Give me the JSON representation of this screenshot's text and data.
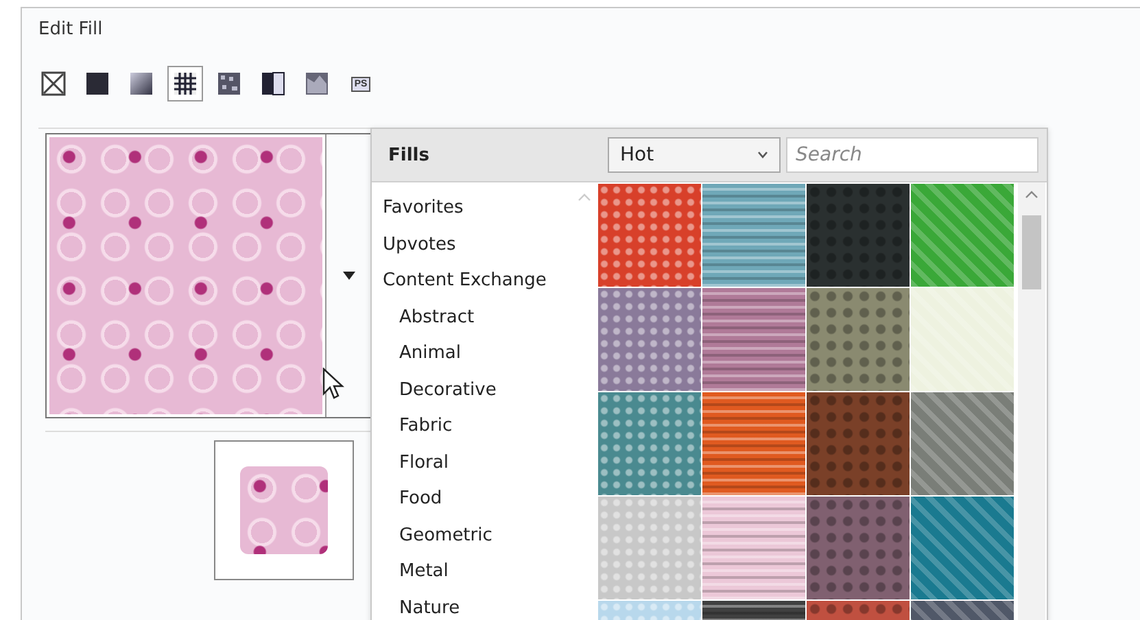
{
  "window": {
    "title": "Edit Fill"
  },
  "fill_types": [
    {
      "kind": "none",
      "selected": false
    },
    {
      "kind": "uniform",
      "selected": false
    },
    {
      "kind": "fountain",
      "selected": false
    },
    {
      "kind": "vector-pattern",
      "selected": true
    },
    {
      "kind": "bitmap-pattern",
      "selected": false
    },
    {
      "kind": "two-color",
      "selected": false
    },
    {
      "kind": "texture",
      "selected": false
    },
    {
      "kind": "postscript",
      "selected": false,
      "label": "PS"
    }
  ],
  "fills_panel": {
    "title": "Fills",
    "dropdown": {
      "value": "Hot"
    },
    "search": {
      "placeholder": "Search"
    },
    "categories": [
      {
        "label": "Favorites"
      },
      {
        "label": "Upvotes"
      },
      {
        "label": "Content Exchange",
        "children": [
          {
            "label": "Abstract"
          },
          {
            "label": "Animal"
          },
          {
            "label": "Decorative"
          },
          {
            "label": "Fabric"
          },
          {
            "label": "Floral"
          },
          {
            "label": "Food"
          },
          {
            "label": "Geometric"
          },
          {
            "label": "Metal"
          },
          {
            "label": "Nature"
          }
        ]
      }
    ],
    "swatches": [
      {
        "color": "#d8402a"
      },
      {
        "color": "#6fa8b8"
      },
      {
        "color": "#2a3030"
      },
      {
        "color": "#3aa838"
      },
      {
        "color": "#8a7a9a"
      },
      {
        "color": "#b07a98"
      },
      {
        "color": "#8a8a70"
      },
      {
        "color": "#eef2e0"
      },
      {
        "color": "#4a8a90"
      },
      {
        "color": "#e05a20"
      },
      {
        "color": "#7a4028"
      },
      {
        "color": "#7a7e78"
      },
      {
        "color": "#c8c8c8"
      },
      {
        "color": "#ecc8d8"
      },
      {
        "color": "#806070"
      },
      {
        "color": "#1a7a90"
      },
      {
        "color": "#b8d8ec"
      },
      {
        "color": "#404040"
      },
      {
        "color": "#c05040"
      },
      {
        "color": "#505868"
      }
    ]
  }
}
